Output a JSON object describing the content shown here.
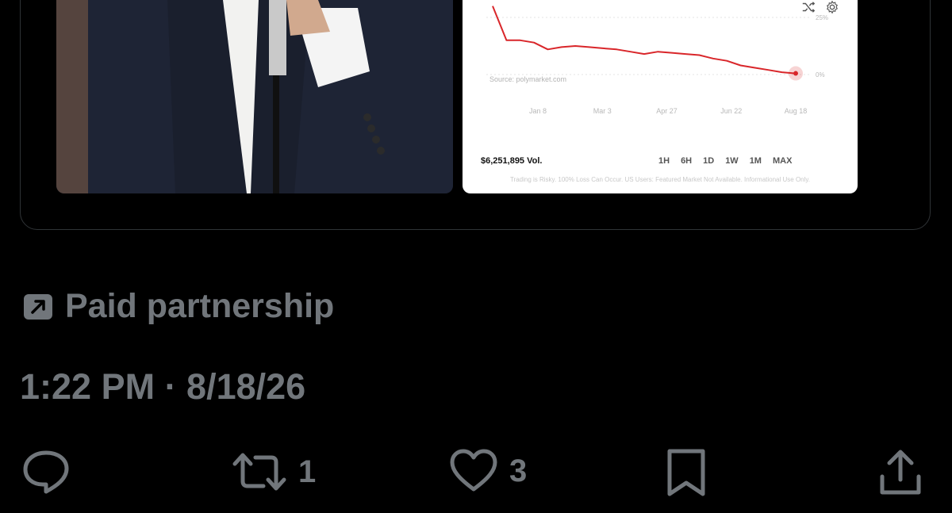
{
  "chart_card": {
    "source": "Source: polymarket.com",
    "volume": "$6,251,895 Vol.",
    "ranges": [
      "1H",
      "6H",
      "1D",
      "1W",
      "1M",
      "MAX"
    ],
    "disclaimer": "Trading is Risky. 100% Loss Can Occur. US Users: Featured Market Not Available. Informational Use Only.",
    "line_color": "#d9262a",
    "chart_data": {
      "type": "line",
      "x_tick_labels": [
        "Jan 8",
        "Mar 3",
        "Apr 27",
        "Jun 22",
        "Aug 18"
      ],
      "y_tick_labels": [
        "25%",
        "0%"
      ],
      "ylim": [
        0,
        25
      ],
      "series": [
        {
          "values": [
            30,
            15,
            15,
            14,
            11,
            12,
            12.5,
            12,
            11.5,
            11,
            10,
            9,
            10,
            9.5,
            9,
            8.5,
            7,
            6,
            4,
            3,
            2,
            1,
            0.5
          ]
        }
      ]
    }
  },
  "post": {
    "paid_label": "Paid partnership",
    "timestamp": "1:22 PM · 8/18/26"
  },
  "actions": {
    "reply_count": "",
    "repost_count": "1",
    "like_count": "3"
  }
}
